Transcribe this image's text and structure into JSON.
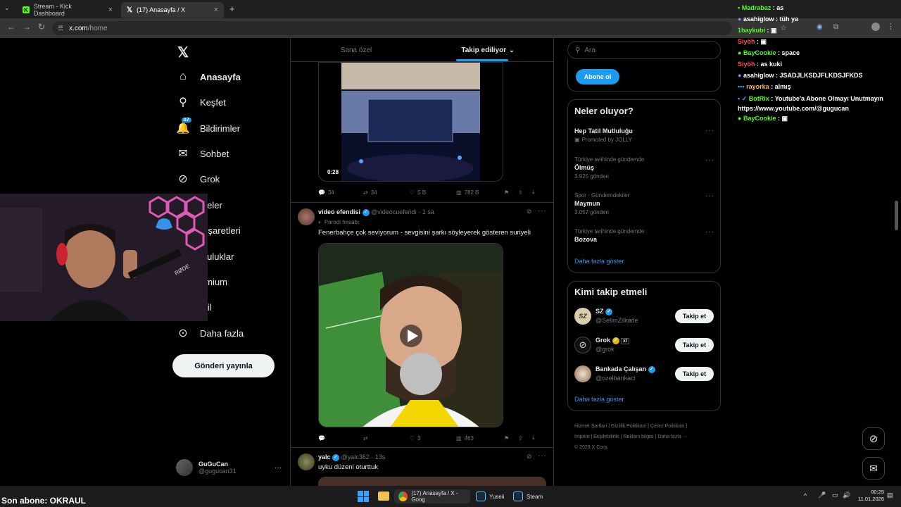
{
  "browser": {
    "tabs": [
      {
        "title": "Stream - Kick Dashboard"
      },
      {
        "title": "(17) Anasayfa / X"
      }
    ],
    "url_domain": "x.com",
    "url_path": "/home"
  },
  "sidebar": {
    "items": [
      {
        "label": "Anasayfa",
        "icon": "home-icon"
      },
      {
        "label": "Keşfet",
        "icon": "search-icon"
      },
      {
        "label": "Bildirimler",
        "icon": "bell-icon",
        "badge": "17"
      },
      {
        "label": "Sohbet",
        "icon": "mail-icon"
      },
      {
        "label": "Grok",
        "icon": "grok-icon"
      },
      {
        "label": "steler",
        "icon": "list-icon"
      },
      {
        "label": "r İşaretleri",
        "icon": "bookmark-icon"
      },
      {
        "label": "pluluklar",
        "icon": "communities-icon"
      },
      {
        "label": "emium",
        "icon": "premium-icon"
      },
      {
        "label": "ofil",
        "icon": "profile-icon"
      },
      {
        "label": "Daha fazla",
        "icon": "more-icon"
      }
    ],
    "post_button": "Gönderi yayınla",
    "account": {
      "name": "GuGuCan",
      "handle": "@gugucan31",
      "more": "···"
    }
  },
  "feed": {
    "tabs": [
      {
        "label": "Sana özel",
        "active": false
      },
      {
        "label": "Takip ediliyor",
        "active": true
      }
    ],
    "post1": {
      "video_time": "0:28",
      "replies": "34",
      "reposts": "34",
      "likes": "5 B",
      "views": "782 B"
    },
    "post2": {
      "name": "video efendisi",
      "handle": "@videocuefendi",
      "time": "· 1 sa",
      "parody": "Parodi hesabı",
      "text": "Fenerbahçe çok seviyorum - sevgisini şarkı söyleyerek gösteren suriyeli",
      "replies": "",
      "reposts": "",
      "likes": "3",
      "views": "463"
    },
    "post3": {
      "name": "yalc",
      "handle": "@yalc362",
      "time": "· 13s",
      "text": "uyku düzeni oturttuk"
    }
  },
  "right": {
    "search_placeholder": "Ara",
    "subscribe_button": "Abone ol",
    "trends_title": "Neler oluyor?",
    "trends": [
      {
        "context": "",
        "name": "Hep Tatil Mutluluğu",
        "meta": "Promoted by JOLLY"
      },
      {
        "context": "Türkiye tarihinde gündemde",
        "name": "Ölmüş",
        "meta": "3.925 gönderi"
      },
      {
        "context": "Spor · Gündemdekiler",
        "name": "Maymun",
        "meta": "3.057 gönderi"
      },
      {
        "context": "Türkiye tarihinde gündemde",
        "name": "Bozova",
        "meta": ""
      }
    ],
    "show_more": "Daha fazla göster",
    "follow_title": "Kimi takip etmeli",
    "follow": [
      {
        "name": "SZ",
        "handle": "@SelimZilkade",
        "button": "Takip et"
      },
      {
        "name": "Grok",
        "handle": "@grok",
        "button": "Takip et"
      },
      {
        "name": "Bankada Çalışan",
        "handle": "@ozelbankaci",
        "button": "Takip et"
      }
    ],
    "follow_more": "Daha fazla göster",
    "footer": [
      "Hizmet Şartları",
      "Gizlilik Politikası",
      "Çerez Politikası",
      "Imprint",
      "Erişilebilirlik",
      "Reklam bilgisi",
      "Daha fazla ···",
      "© 2026 X Corp."
    ]
  },
  "chat": [
    {
      "user": "Madrabaz",
      "msg": "as",
      "color": "#ffffff"
    },
    {
      "user": "asahiglow",
      "msg": "tüh ya",
      "color": "#ffffff"
    },
    {
      "user": "1baykubi",
      "msg": "",
      "color": "#53fc18"
    },
    {
      "user": "Siyöh",
      "msg": "",
      "color": "#ff4d4d"
    },
    {
      "user": "BayCookie",
      "msg": "space",
      "color": "#53fc18"
    },
    {
      "user": "Siyöh",
      "msg": "as kuki",
      "color": "#ff4d4d"
    },
    {
      "user": "asahiglow",
      "msg": "JSADJLKSDJFLKDSJFKDS",
      "color": "#ffffff"
    },
    {
      "user": "rayorka",
      "msg": "almış",
      "color": "#ffb347"
    },
    {
      "user": "BotRix",
      "msg": "Youtube'a Abone Olmayı Unutmayın https://www.youtube.com/@gugucan",
      "color": "#53fc18"
    },
    {
      "user": "BayCookie",
      "msg": "",
      "color": "#53fc18"
    }
  ],
  "overlay": {
    "last_sub": "Son abone: OKRAUL"
  },
  "taskbar": {
    "items": [
      {
        "label": "(17) Anasayfa / X - Goog"
      },
      {
        "label": "Yuseii"
      },
      {
        "label": "Steam"
      }
    ],
    "time": "00:25",
    "date": "11.01.2026"
  }
}
